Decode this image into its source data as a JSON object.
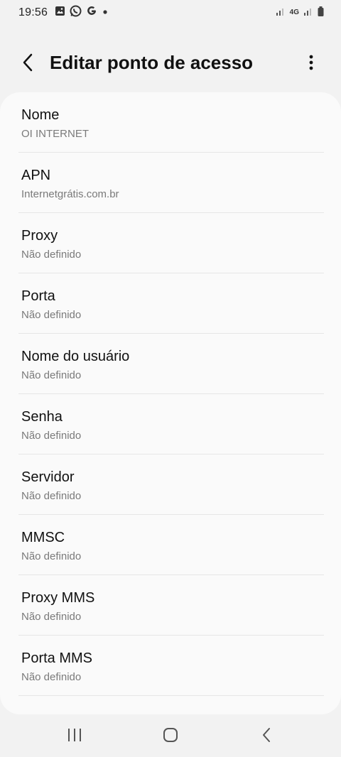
{
  "status_bar": {
    "time": "19:56",
    "network": "4G",
    "icons": [
      "gallery-icon",
      "whatsapp-icon",
      "google-icon",
      "dot-icon",
      "signal-icon",
      "signal-icon",
      "battery-icon"
    ]
  },
  "header": {
    "title": "Editar ponto de acesso",
    "back_icon": "back-arrow-icon",
    "more_icon": "more-vert-icon"
  },
  "settings": [
    {
      "label": "Nome",
      "value": "OI INTERNET"
    },
    {
      "label": "APN",
      "value": "Internetgrátis.com.br"
    },
    {
      "label": "Proxy",
      "value": "Não definido"
    },
    {
      "label": "Porta",
      "value": "Não definido"
    },
    {
      "label": "Nome do usuário",
      "value": "Não definido"
    },
    {
      "label": "Senha",
      "value": "Não definido"
    },
    {
      "label": "Servidor",
      "value": "Não definido"
    },
    {
      "label": "MMSC",
      "value": "Não definido"
    },
    {
      "label": "Proxy MMS",
      "value": "Não definido"
    },
    {
      "label": "Porta MMS",
      "value": "Não definido"
    }
  ],
  "nav_bar": {
    "icons": [
      "recents-icon",
      "home-icon",
      "back-icon"
    ]
  },
  "colors": {
    "background": "#f2f2f2",
    "card": "#fafafa",
    "secondary_text": "#7a7a7a"
  }
}
